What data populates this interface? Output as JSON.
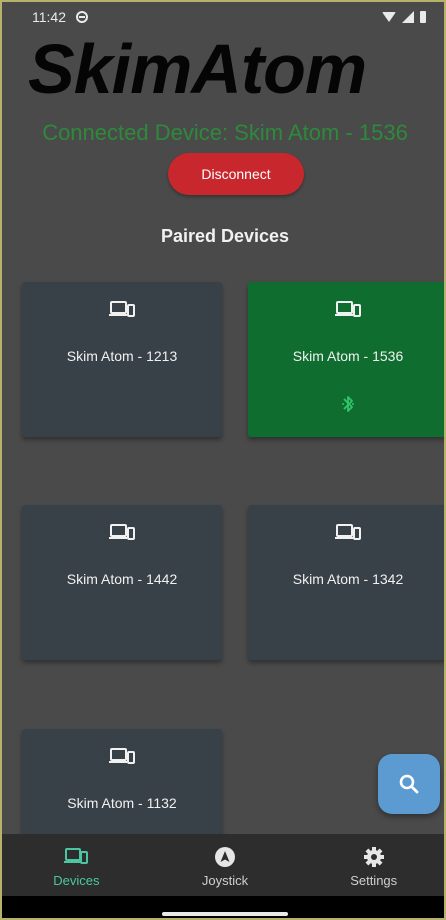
{
  "status_bar": {
    "time": "11:42",
    "icons": [
      "camera-icon",
      "wifi-icon",
      "signal-icon",
      "battery-icon"
    ]
  },
  "app": {
    "logo_text": "SkimAtom"
  },
  "connection": {
    "status_text": "Connected Device: Skim Atom - 1536",
    "disconnect_label": "Disconnect",
    "status_color": "#2e8a3a",
    "button_color": "#c8272d"
  },
  "paired": {
    "title": "Paired Devices",
    "devices": [
      {
        "name": "Skim Atom - 1213",
        "icon": "devices-icon",
        "selected": false
      },
      {
        "name": "Skim Atom - 1536",
        "icon": "devices-icon",
        "selected": true,
        "status_icon": "bluetooth-icon"
      },
      {
        "name": "Skim Atom - 1442",
        "icon": "devices-icon",
        "selected": false
      },
      {
        "name": "Skim Atom - 1342",
        "icon": "devices-icon",
        "selected": false
      },
      {
        "name": "Skim Atom - 1132",
        "icon": "devices-icon",
        "selected": false
      }
    ]
  },
  "fab": {
    "icon": "search-icon",
    "color": "#5b9bd1"
  },
  "bottom_nav": {
    "items": [
      {
        "label": "Devices",
        "icon": "devices-icon",
        "active": true
      },
      {
        "label": "Joystick",
        "icon": "navigation-icon",
        "active": false
      },
      {
        "label": "Settings",
        "icon": "gear-icon",
        "active": false
      }
    ],
    "active_color": "#4cc6a0"
  }
}
